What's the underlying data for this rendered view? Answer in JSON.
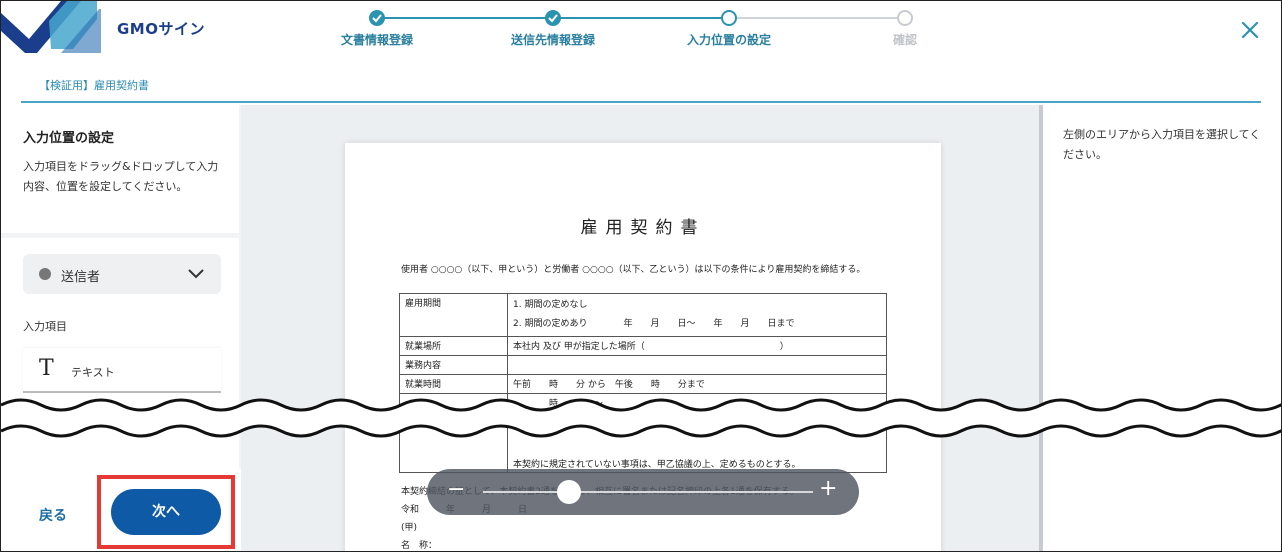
{
  "header": {
    "logo_text": "GMOサイン",
    "close_icon": "close-icon",
    "steps": [
      {
        "label": "文書情報登録",
        "state": "done"
      },
      {
        "label": "送信先情報登録",
        "state": "done"
      },
      {
        "label": "入力位置の設定",
        "state": "current"
      },
      {
        "label": "確認",
        "state": "todo"
      }
    ]
  },
  "doc_tab": {
    "label": "【検証用】雇用契約書"
  },
  "left_panel": {
    "title": "入力位置の設定",
    "description": "入力項目をドラッグ&ドロップして入力内容、位置を設定してください。",
    "sender": {
      "label": "送信者",
      "icon": "chevron-down-icon"
    },
    "items_label": "入力項目",
    "items": [
      {
        "icon": "T",
        "label": "テキスト"
      }
    ]
  },
  "document": {
    "title": "雇用契約書",
    "intro": "使用者 ○○○○（以下、甲という）と労働者 ○○○○（以下、乙という）は以下の条件により雇用契約を締結する。",
    "rows": [
      {
        "key": "雇用期間",
        "value": "1. 期間の定めなし\n2. 期間の定めあり　　　　年　　月　　日～　　年　　月　　日まで"
      },
      {
        "key": "就業場所",
        "value": "本社内 及び 甲が指定した場所（　　　　　　　　　　　　　　　）"
      },
      {
        "key": "業務内容",
        "value": ""
      },
      {
        "key": "就業時間",
        "value": "午前　　時　　分 から　午後　　時　　分まで"
      },
      {
        "key": "",
        "value": "　　　　時　　　　～　　　　　　分"
      },
      {
        "key": "",
        "value": "本契約に規定されていない事項は、甲乙協議の上、定めるものとする。"
      }
    ],
    "footer": "本契約締結の証として、本契約書2通を作成し、相互に署名または記名押印の上各1通を保有する。\n令和　　　年　　　月　　　日\n(甲)\n名　称："
  },
  "right_panel": {
    "hint": "左側のエリアから入力項目を選択してください。"
  },
  "bottom": {
    "back_label": "戻る",
    "next_label": "次へ"
  },
  "zoom": {
    "minus": "−",
    "plus": "+",
    "level": 0.26
  },
  "colors": {
    "accent": "#2a93b0",
    "primary_button": "#0f5aa6",
    "highlight": "#e53935",
    "logo": "#1a3e8c"
  }
}
